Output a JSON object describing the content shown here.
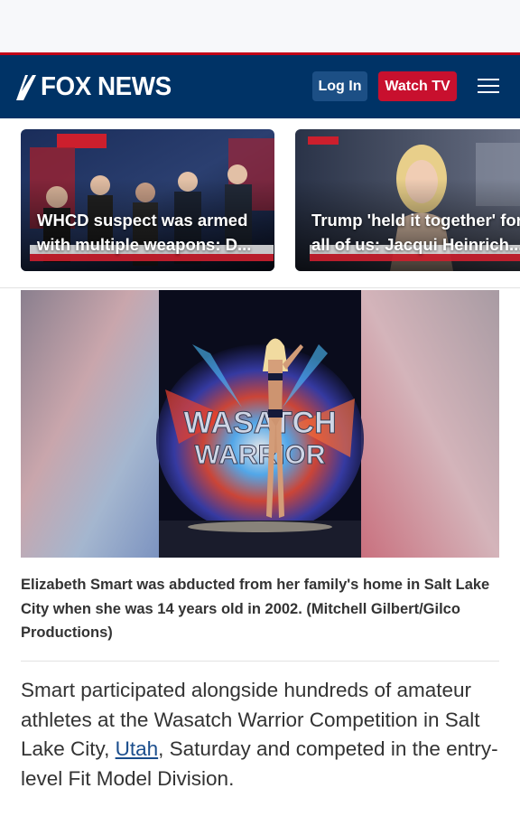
{
  "header": {
    "logo_text": "FOX NEWS",
    "login_label": "Log In",
    "watch_label": "Watch TV",
    "menu_icon": "hamburger-menu-icon"
  },
  "cards": [
    {
      "title_line1": "WHCD suspect was armed",
      "title_line2": "with multiple weapons: D..."
    },
    {
      "title_line1": "Trump 'held it together' for",
      "title_line2": "all of us: Jacqui Heinrich..."
    }
  ],
  "main_image": {
    "banner_line1": "WASATCH",
    "banner_line2": "WARRIOR"
  },
  "caption": "Elizabeth Smart was abducted from her family's home in Salt Lake City when she was 14 years old in 2002. (Mitchell Gilbert/Gilco Productions)",
  "article": {
    "before_link": "Smart participated alongside hundreds of amateur athletes at the Wasatch Warrior Competition in Salt Lake City, ",
    "link_text": "Utah",
    "after_link": ", Saturday and competed in the entry-level Fit Model Division."
  },
  "colors": {
    "header_bg": "#003366",
    "accent_red": "#c8102e",
    "login_bg": "#1c4f85",
    "link": "#1a4d8c"
  }
}
